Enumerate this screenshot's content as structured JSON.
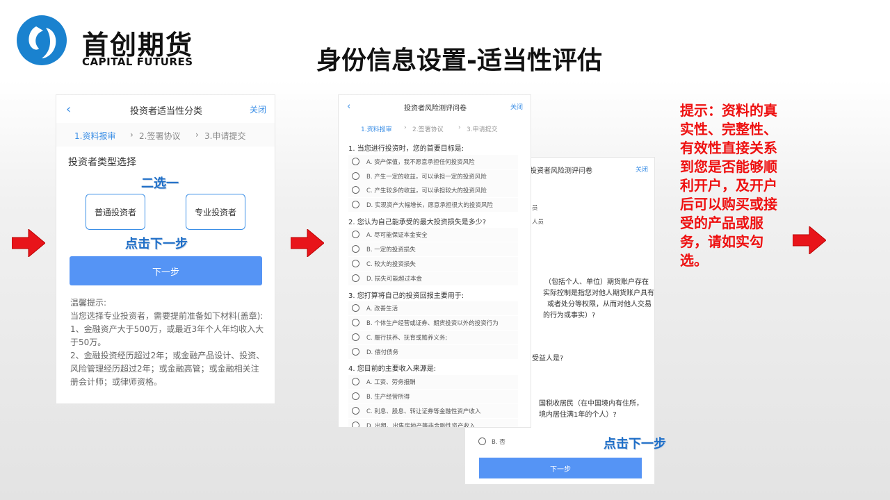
{
  "page": {
    "title": "身份信息设置-适当性评估",
    "logo": {
      "cn": "首创期货",
      "en": "CAPITAL FUTURES"
    }
  },
  "colors": {
    "accent": "#3a8ee6",
    "button": "#5594f5",
    "note": "#ee1111",
    "arrow": "#e8141a"
  },
  "panel1": {
    "back_icon": "chevron-left-icon",
    "title": "投资者适当性分类",
    "close": "关闭",
    "steps": [
      "1.资料报审",
      "›",
      "2.签署协议",
      "›",
      "3.申请提交"
    ],
    "type_title": "投资者类型选择",
    "types": [
      "普通投资者",
      "专业投资者"
    ],
    "annotation_choose": "二选一",
    "annotation_next": "点击下一步",
    "next_button": "下一步",
    "tips": [
      "温馨提示:",
      "当您选择专业投资者，需要提前准备如下材料(盖章):",
      "1、金融资产大于500万，或最近3年个人年均收入大于50万。",
      "2、金融投资经历超过2年；或金融产品设计、投资、风险管理经历超过2年；或金融高管；或金融相关注册会计师；或律师资格。"
    ]
  },
  "panel2": {
    "back_icon": "chevron-left-icon",
    "title": "投资者风险测评问卷",
    "close": "关闭",
    "steps": [
      "1.资料报审",
      "›",
      "2.签署协议",
      "›",
      "3.申请提交"
    ],
    "questions": [
      {
        "q": "1. 当您进行投资时，您的首要目标是:",
        "options": [
          "A.  资产保值，我不愿意承担任何投资风险",
          "B.  产生一定的收益，可以承担一定的投资风险",
          "C.  产生较多的收益，可以承担较大的投资风险",
          "D.  实现资产大幅增长，愿意承担很大的投资风险"
        ]
      },
      {
        "q": "2. 您认为自己能承受的最大投资损失是多少?",
        "options": [
          "A.  尽可能保证本金安全",
          "B.  一定的投资损失",
          "C.  较大的投资损失",
          "D.  损失可能超过本金"
        ]
      },
      {
        "q": "3. 您打算将自己的投资回报主要用于:",
        "options": [
          "A.  改善生活",
          "B.  个体生产经营或证券、期货投资以外的投资行为",
          "C.  履行扶养、抚育或赡养义务;",
          "D.  偿付债务"
        ]
      },
      {
        "q": "4. 您目前的主要收入来源是:",
        "options": [
          "A. 工资、劳务报酬",
          "B. 生产经营所得",
          "C. 利息、股息、转让证券等金融性资产收入",
          "D. 出租、出售房地产等非金融性资产收入"
        ]
      }
    ]
  },
  "panel3": {
    "title": "投资者风险测评问卷",
    "close": "关闭",
    "fragments": [
      "员",
      "人员",
      "（包括个人、单位）期货账户存在",
      "实际控制是指您对他人期货账户具有",
      "或者处分等权限，从而对他人交易",
      "的行为或事实）?",
      "受益人是?",
      "国税收居民（在中国境内有住所，",
      "境内居住满1年的个人）?"
    ],
    "option_b": "B. 否",
    "next_button": "下一步",
    "annotation_next": "点击下一步"
  },
  "note": "提示：资料的真实性、完整性、有效性直接关系到您是否能够顺利开户，及开户后可以购买或接受的产品或服务，请如实勾选。"
}
